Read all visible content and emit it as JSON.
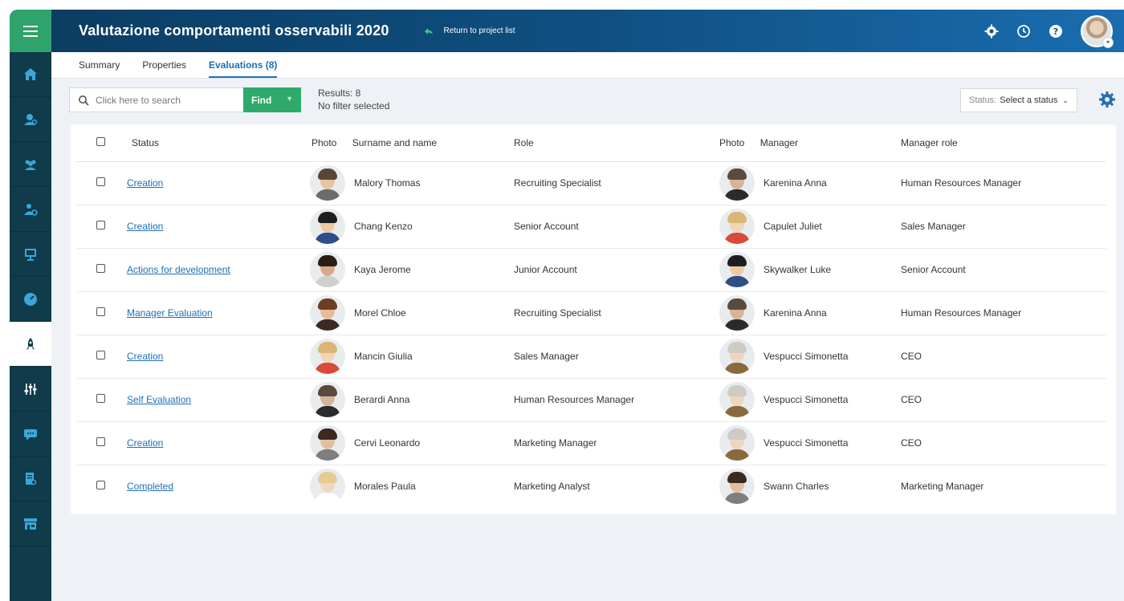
{
  "header": {
    "title": "Valutazione comportamenti osservabili 2020",
    "back_label": "Return to project list"
  },
  "tabs": [
    {
      "label": "Summary"
    },
    {
      "label": "Properties"
    },
    {
      "label": "Evaluations (8)"
    }
  ],
  "toolbar": {
    "search_placeholder": "Click here to search",
    "find_label": "Find",
    "results": "Results: 8",
    "filter": "No filter selected",
    "status_label": "Status:",
    "status_value": "Select a status"
  },
  "table": {
    "columns": {
      "status": "Status",
      "photo": "Photo",
      "name": "Surname and name",
      "role": "Role",
      "photo2": "Photo",
      "manager": "Manager",
      "manager_role": "Manager role"
    },
    "rows": [
      {
        "status": "Creation",
        "name": "Malory Thomas",
        "role": "Recruiting Specialist",
        "manager": "Karenina Anna",
        "manager_role": "Human Resources Manager"
      },
      {
        "status": "Creation",
        "name": "Chang Kenzo",
        "role": "Senior Account",
        "manager": "Capulet Juliet",
        "manager_role": "Sales Manager"
      },
      {
        "status": "Actions for development",
        "name": "Kaya Jerome",
        "role": "Junior Account",
        "manager": "Skywalker Luke",
        "manager_role": "Senior Account"
      },
      {
        "status": "Manager Evaluation",
        "name": "Morel Chloe",
        "role": "Recruiting Specialist",
        "manager": "Karenina Anna",
        "manager_role": "Human Resources Manager"
      },
      {
        "status": "Creation",
        "name": "Mancin Giulia",
        "role": "Sales Manager",
        "manager": "Vespucci Simonetta",
        "manager_role": "CEO"
      },
      {
        "status": "Self Evaluation",
        "name": "Berardi Anna",
        "role": "Human Resources Manager",
        "manager": "Vespucci Simonetta",
        "manager_role": "CEO"
      },
      {
        "status": "Creation",
        "name": "Cervi Leonardo",
        "role": "Marketing Manager",
        "manager": "Vespucci Simonetta",
        "manager_role": "CEO"
      },
      {
        "status": "Completed",
        "name": "Morales Paula",
        "role": "Marketing Analyst",
        "manager": "Swann Charles",
        "manager_role": "Marketing Manager"
      }
    ]
  },
  "colors": {
    "accent_green": "#2eab6a",
    "header_blue": "#0f4f80",
    "link_blue": "#1f6fb2",
    "sidebar": "#0f3b4a"
  },
  "sidebar_icons": [
    "menu-icon",
    "home-icon",
    "people-search-icon",
    "team-icon",
    "user-settings-icon",
    "presentation-icon",
    "dashboard-icon",
    "rocket-icon",
    "sliders-icon",
    "chat-icon",
    "report-search-icon",
    "store-icon"
  ]
}
